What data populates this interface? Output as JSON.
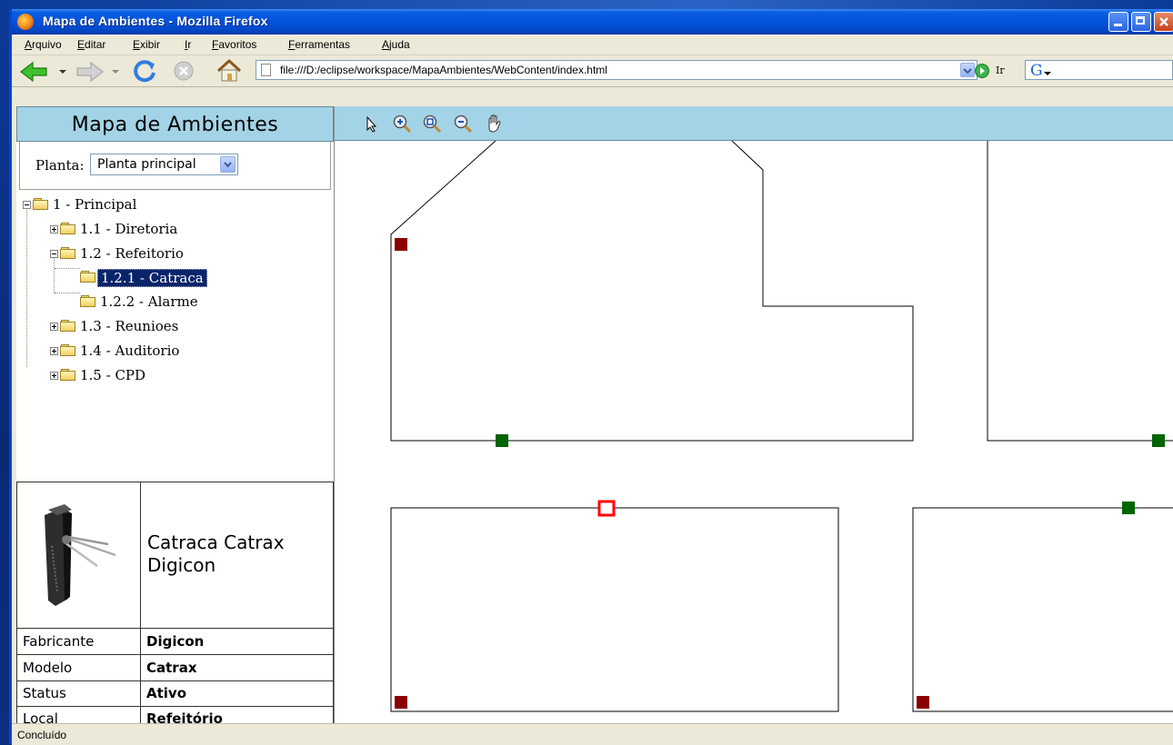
{
  "window": {
    "title": "Mapa de Ambientes - Mozilla Firefox"
  },
  "menubar": {
    "items": [
      "Arquivo",
      "Editar",
      "Exibir",
      "Ir",
      "Favoritos",
      "Ferramentas",
      "Ajuda"
    ]
  },
  "navbar": {
    "url": "file:///D:/eclipse/workspace/MapaAmbientes/WebContent/index.html",
    "go_label": "Ir"
  },
  "app": {
    "title": "Mapa de Ambientes",
    "planta_label": "Planta:",
    "planta_value": "Planta principal"
  },
  "tree": {
    "items": [
      {
        "label": "1 - Principal",
        "level": 0,
        "expander": "minus",
        "selected": false
      },
      {
        "label": "1.1 - Diretoria",
        "level": 1,
        "expander": "plus",
        "selected": false
      },
      {
        "label": "1.2 - Refeitorio",
        "level": 1,
        "expander": "minus",
        "selected": false
      },
      {
        "label": "1.2.1 - Catraca",
        "level": 2,
        "expander": "none",
        "selected": true
      },
      {
        "label": "1.2.2 - Alarme",
        "level": 2,
        "expander": "none",
        "selected": false
      },
      {
        "label": "1.3 - Reunioes",
        "level": 1,
        "expander": "plus",
        "selected": false
      },
      {
        "label": "1.4 - Auditorio",
        "level": 1,
        "expander": "plus",
        "selected": false
      },
      {
        "label": "1.5 - CPD",
        "level": 1,
        "expander": "plus",
        "selected": false
      }
    ]
  },
  "device": {
    "name": "Catraca Catrax Digicon",
    "image": "turnstile-image",
    "properties": [
      {
        "key": "Fabricante",
        "value": "Digicon"
      },
      {
        "key": "Modelo",
        "value": "Catrax"
      },
      {
        "key": "Status",
        "value": "Ativo"
      },
      {
        "key": "Local",
        "value": "Refeitório"
      }
    ]
  },
  "map_toolbar": {
    "tools": [
      "pointer-icon",
      "zoom-in-icon",
      "zoom-region-icon",
      "zoom-out-icon",
      "pan-hand-icon"
    ]
  },
  "map": {
    "colors": {
      "sensor_alert": "#8b0000",
      "sensor_ok": "#006400",
      "sensor_selected": "#ff0000"
    }
  },
  "statusbar": {
    "text": "Concluído"
  },
  "colors": {
    "panel_header": "#a3d3e6",
    "selection": "#0a246a",
    "titlebar": "#0453dd"
  }
}
